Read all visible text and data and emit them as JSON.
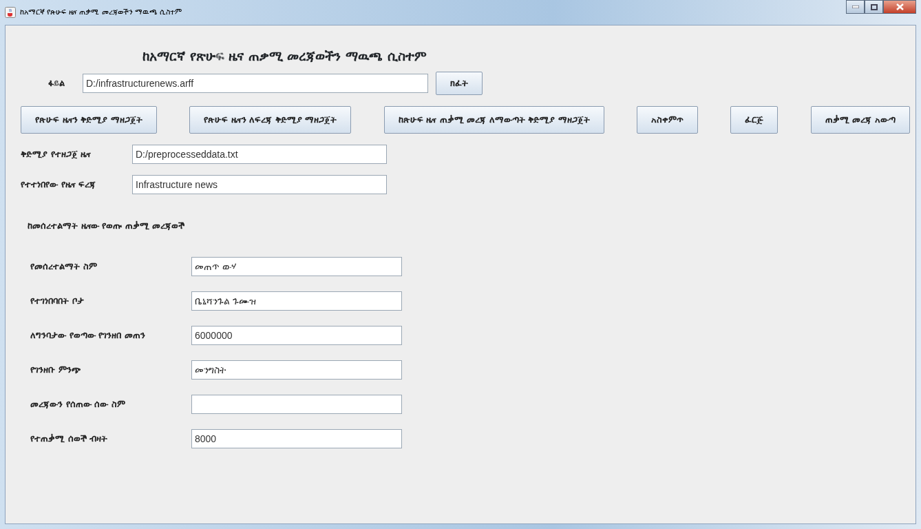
{
  "window": {
    "title": "ከአማርኛ የጽሁፍ ዜና ጠቃሚ መረጃወችን ማዉጫ ሲስተም"
  },
  "heading": "ከአማርኛ የጽሁፍ ዜና ጠቃሚ መረጃወችን ማዉጫ ሲስተም",
  "file": {
    "label": "ፋይል",
    "value": "D:/infrastructurenews.arff",
    "button": "ክፈት"
  },
  "actions": [
    "የጽሁፍ ዜናን ቅድሚያ ማዘጋጀት",
    "የጽሁፍ ዜናን ለፍረጃ ቅድሚያ ማዘጋጀት",
    "ከጽሁፍ ዜና ጠቃሚ መረጃ ለማውጣት ቅድሚያ ማዘጋጀት",
    "አስቀምጥ",
    "ፈርጅ",
    "ጠቃሚ መረጃ አውጣ"
  ],
  "results": [
    {
      "label": "ቅድሚያ የተዘጋጀ ዜና",
      "value": "D:/preprocesseddata.txt"
    },
    {
      "label": "የተተነበየው የዜና ፍረጃ",
      "value": "Infrastructure news"
    }
  ],
  "section_title": "ከመሰረተልማት ዜናው የወጡ ጠቃሚ መረጃወች",
  "fields": [
    {
      "label": "የመሰረተልማት ስም",
      "value": "መጠጥ ውሃ"
    },
    {
      "label": "የተገነበባበት ቦታ",
      "value": "ቤኒሻንጉል ጉሙዝ"
    },
    {
      "label": "ለግንባታው የወጣው የገንዘበ መጠን",
      "value": "6000000"
    },
    {
      "label": "የገንዘቡ ምንጭ",
      "value": "መንግስት"
    },
    {
      "label": "መረጃውን የሰጠው ሰው ስም"
    },
    {
      "label": "የተጠቃሚ ሰወች ብዛት",
      "value": "8000"
    }
  ]
}
